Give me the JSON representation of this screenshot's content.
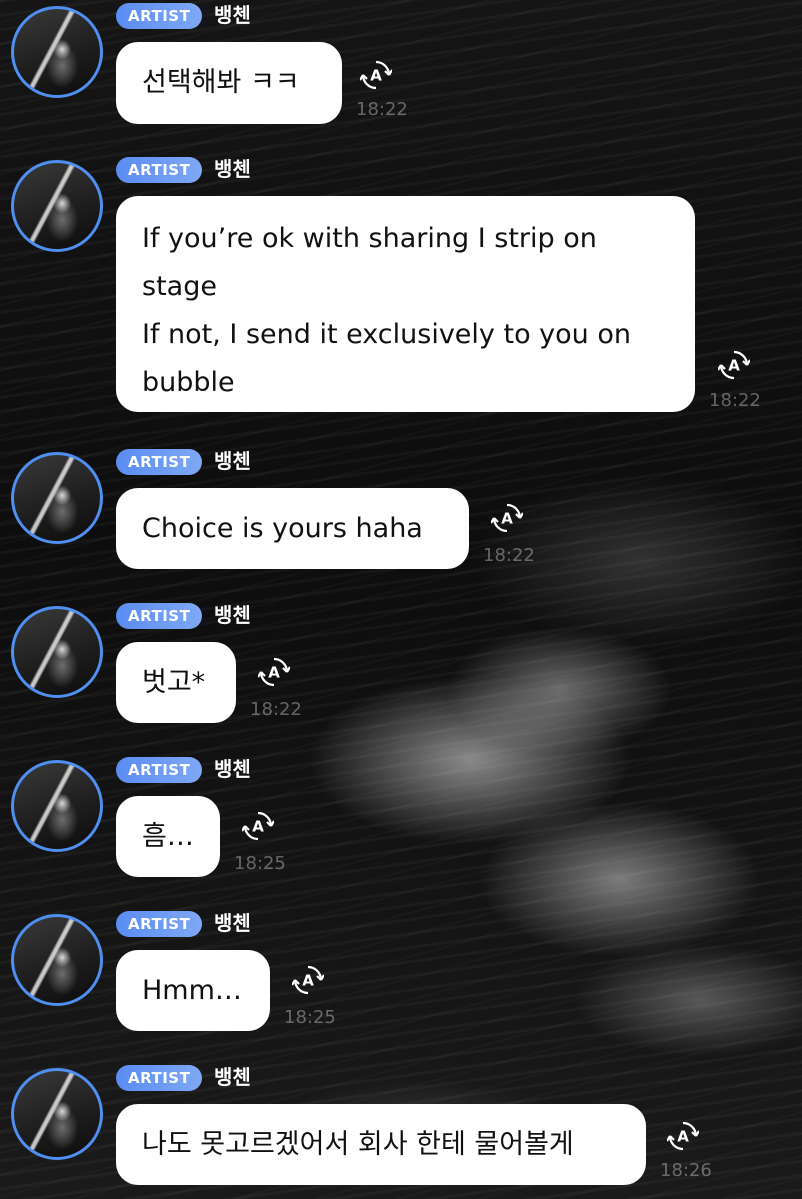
{
  "messages": [
    {
      "badge": "ARTIST",
      "sender": "뱅첸",
      "text": "선택해봐 ㅋㅋ",
      "time": "18:22"
    },
    {
      "badge": "ARTIST",
      "sender": "뱅첸",
      "text": "If you’re ok with sharing I strip on\nstage\nIf not, I send it exclusively to you on\nbubble",
      "time": "18:22"
    },
    {
      "badge": "ARTIST",
      "sender": "뱅첸",
      "text": "Choice is yours haha",
      "time": "18:22"
    },
    {
      "badge": "ARTIST",
      "sender": "뱅첸",
      "text": "벗고*",
      "time": "18:22"
    },
    {
      "badge": "ARTIST",
      "sender": "뱅첸",
      "text": "흠…",
      "time": "18:25"
    },
    {
      "badge": "ARTIST",
      "sender": "뱅첸",
      "text": "Hmm…",
      "time": "18:25"
    },
    {
      "badge": "ARTIST",
      "sender": "뱅첸",
      "text": "나도 못고르겠어서 회사 한테 물어볼게",
      "time": "18:26"
    }
  ],
  "icons": {
    "avatar": "artist-avatar",
    "translate": "translate-icon"
  },
  "colors": {
    "badge": "#5a8cf2",
    "avatar_ring": "#4f8ff0",
    "bubble": "#ffffff"
  }
}
